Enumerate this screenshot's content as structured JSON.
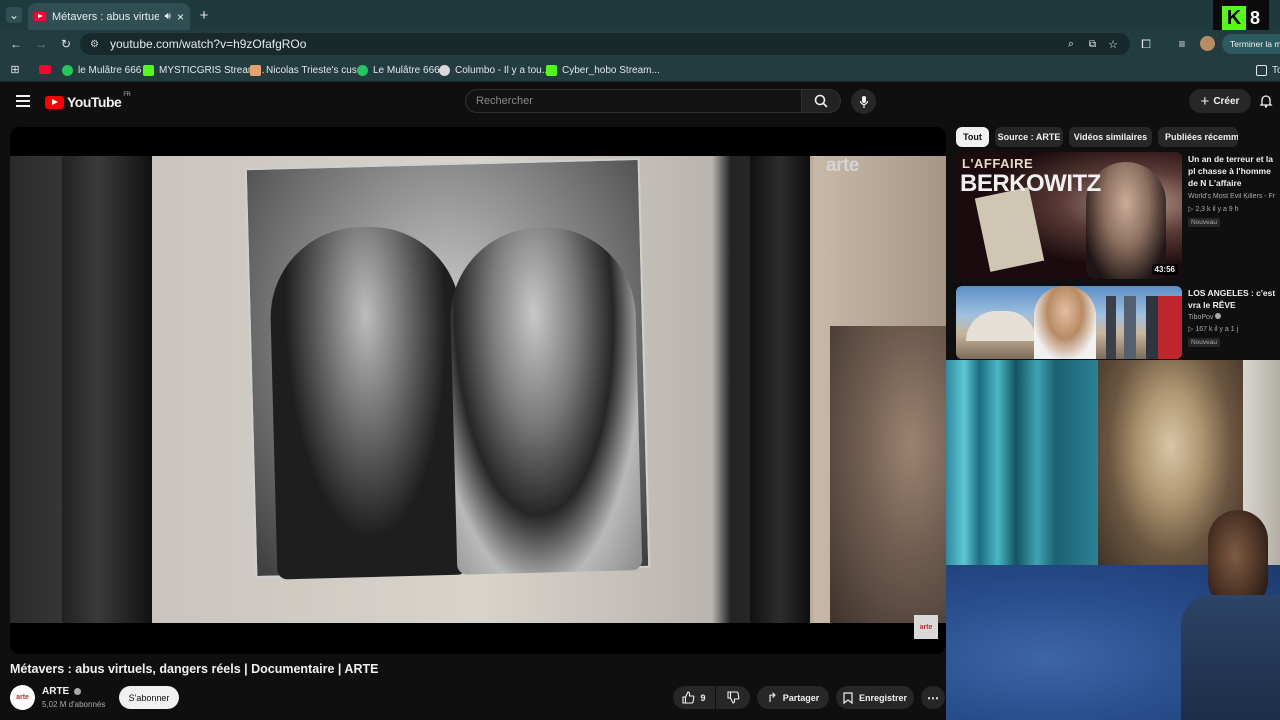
{
  "browser": {
    "tab_title": "Métavers : abus virtuels, da",
    "url": "youtube.com/watch?v=h9zOfafgROo",
    "profile_label": "Terminer la m",
    "bookmarks": [
      {
        "label": "le Mulâtre 666",
        "color": "#22c55e"
      },
      {
        "label": "MYSTICGRIS Stream...",
        "color": "#53fc18"
      },
      {
        "label": "Nicolas Trieste's cus...",
        "color": "#e8a070"
      },
      {
        "label": "Le Mulâtre 666",
        "color": "#22c55e"
      },
      {
        "label": "Columbo - Il y a tou...",
        "color": "#d9d9d9"
      },
      {
        "label": "Cyber_hobo Stream...",
        "color": "#53fc18"
      }
    ],
    "bookmark_overflow": "To"
  },
  "overlay": {
    "kick_count": "8"
  },
  "youtube": {
    "logo": "YouTube",
    "region": "FR",
    "search_placeholder": "Rechercher",
    "create_label": "Créer"
  },
  "video": {
    "title": "Métavers : abus virtuels, dangers réels | Documentaire | ARTE",
    "watermark": "arte",
    "corner_logo": "arte",
    "channel": {
      "name": "ARTE",
      "subs": "5,02 M d'abonnés",
      "avatar": "arte"
    },
    "subscribe": "S'abonner",
    "likes": "9",
    "share": "Partager",
    "save": "Enregistrer"
  },
  "chips": [
    "Tout",
    "Source : ARTE",
    "Vidéos similaires",
    "Publiées récemm"
  ],
  "recommended": [
    {
      "title": "Un an de terreur et la pl chasse à l'homme de N L'affaire BERKOWITZ",
      "channel": "World's Most Evil Killers - Fr",
      "meta": "2,3 k  il y a 9 h",
      "badge": "Nouveau",
      "duration": "43:56",
      "thumb_text_1": "L'AFFAIRE",
      "thumb_text_2": "BERKOWITZ"
    },
    {
      "title": "LOS ANGELES : c'est vra le RÊVE AMÉRICAIN ?!",
      "channel": "TiboPov",
      "meta": "167 k  il y a 1 j",
      "badge": "Nouveau"
    }
  ]
}
